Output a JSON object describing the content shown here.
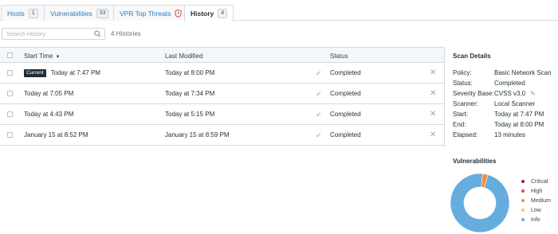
{
  "tabs": [
    {
      "label": "Hosts",
      "badge": "1"
    },
    {
      "label": "Vulnerabilities",
      "badge": "33"
    },
    {
      "label": "VPR Top Threats",
      "icon": "shield-icon"
    },
    {
      "label": "History",
      "badge": "4"
    }
  ],
  "active_tab": "History",
  "search": {
    "placeholder": "Search History",
    "count": "4 Histories"
  },
  "table": {
    "columns": [
      "Start Time",
      "Last Modified",
      "Status"
    ],
    "sort_indicator": "▼",
    "current_badge": "Current",
    "rows": [
      {
        "start": "Today at 7:47 PM",
        "modified": "Today at 8:00 PM",
        "status": "Completed",
        "current": true
      },
      {
        "start": "Today at 7:05 PM",
        "modified": "Today at 7:34 PM",
        "status": "Completed",
        "current": false
      },
      {
        "start": "Today at 4:43 PM",
        "modified": "Today at 5:15 PM",
        "status": "Completed",
        "current": false
      },
      {
        "start": "January 15 at 8:52 PM",
        "modified": "January 15 at 8:59 PM",
        "status": "Completed",
        "current": false
      }
    ]
  },
  "scan_details": {
    "title": "Scan Details",
    "fields": [
      {
        "label": "Policy:",
        "value": "Basic Network Scan"
      },
      {
        "label": "Status:",
        "value": "Completed"
      },
      {
        "label": "Severity Base:",
        "value": "CVSS v3.0"
      },
      {
        "label": "Scanner:",
        "value": "Local Scanner"
      },
      {
        "label": "Start:",
        "value": "Today at 7:47 PM"
      },
      {
        "label": "End:",
        "value": "Today at 8:00 PM"
      },
      {
        "label": "Elapsed:",
        "value": "13 minutes"
      }
    ]
  },
  "vulnerabilities": {
    "title": "Vulnerabilities",
    "legend": [
      {
        "label": "Critical",
        "color": "#91243e"
      },
      {
        "label": "High",
        "color": "#dd4b50"
      },
      {
        "label": "Medium",
        "color": "#f18c43"
      },
      {
        "label": "Low",
        "color": "#f8c851"
      },
      {
        "label": "Info",
        "color": "#67acdf"
      }
    ],
    "chart_data": {
      "type": "pie",
      "categories": [
        "Critical",
        "High",
        "Medium",
        "Low",
        "Info"
      ],
      "values": [
        0,
        0,
        1,
        0,
        32
      ]
    }
  }
}
